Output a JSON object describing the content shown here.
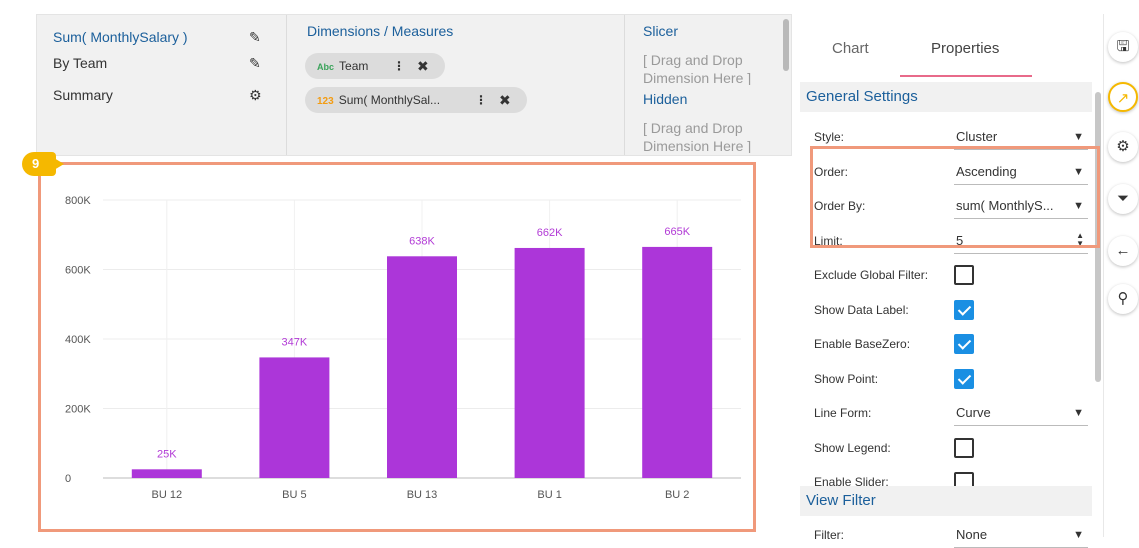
{
  "top_panel": {
    "measure_label": "Sum( MonthlySalary )",
    "team_label": "By Team",
    "summary_label": "Summary",
    "dims_title": "Dimensions / Measures",
    "pill_team": {
      "tag": "Abc",
      "label": "Team"
    },
    "pill_sum": {
      "tag": "123",
      "label": "Sum( MonthlySal..."
    },
    "slicer_title": "Slicer",
    "slicer_placeholder": "[ Drag and Drop Dimension Here ]",
    "hidden_title": "Hidden",
    "hidden_placeholder": "[ Drag and Drop Dimension Here ]"
  },
  "badge": "9",
  "chart_data": {
    "type": "bar",
    "categories": [
      "BU 12",
      "BU 5",
      "BU 13",
      "BU 1",
      "BU 2"
    ],
    "values": [
      25000,
      347000,
      638000,
      662000,
      665000
    ],
    "data_labels": [
      "25K",
      "347K",
      "638K",
      "662K",
      "665K"
    ],
    "y_ticks": [
      0,
      200000,
      400000,
      600000,
      800000
    ],
    "y_tick_labels": [
      "0",
      "200K",
      "400K",
      "600K",
      "800K"
    ],
    "ylim": [
      0,
      800000
    ],
    "bar_color": "#ac36d9",
    "label_color": "#b23bd6",
    "grid": true
  },
  "properties": {
    "tabs": [
      "Chart",
      "Properties"
    ],
    "general_settings": "General Settings",
    "rows": [
      {
        "label": "Style:",
        "type": "select",
        "value": "Cluster"
      },
      {
        "label": "Order:",
        "type": "select",
        "value": "Ascending"
      },
      {
        "label": "Order By:",
        "type": "select",
        "value": "sum( MonthlyS..."
      },
      {
        "label": "Limit:",
        "type": "number",
        "value": "5"
      },
      {
        "label": "Exclude Global Filter:",
        "type": "checkbox",
        "checked": false
      },
      {
        "label": "Show Data Label:",
        "type": "checkbox",
        "checked": true
      },
      {
        "label": "Enable BaseZero:",
        "type": "checkbox",
        "checked": true
      },
      {
        "label": "Show Point:",
        "type": "checkbox",
        "checked": true
      },
      {
        "label": "Line Form:",
        "type": "select",
        "value": "Curve"
      },
      {
        "label": "Show Legend:",
        "type": "checkbox",
        "checked": false
      },
      {
        "label": "Enable Slider:",
        "type": "checkbox",
        "checked": false
      }
    ],
    "view_filter": "View Filter",
    "filter_label": "Filter:",
    "filter_value": "None"
  },
  "toolbar_icons": [
    "save-icon",
    "chart-icon",
    "settings-gears-icon",
    "filter-icon",
    "back-arrow-icon",
    "bulb-icon"
  ],
  "accent_color": "#f0997b"
}
